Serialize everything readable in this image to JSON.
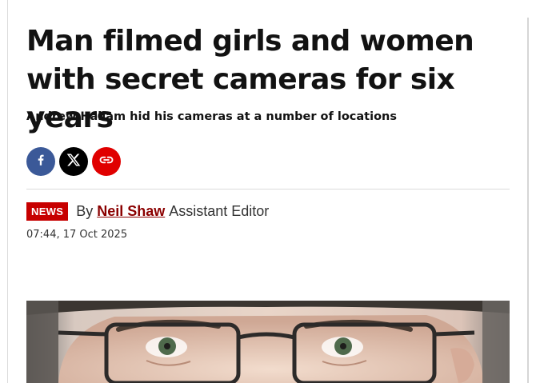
{
  "article": {
    "headline": "Man filmed girls and women with secret cameras for six years",
    "standfirst": "Andrew Hallam hid his cameras at a number of locations",
    "category_badge": "NEWS",
    "byline_prefix": "By",
    "author": "Neil Shaw",
    "author_role": "Assistant Editor",
    "published": "07:44, 17 Oct 2025"
  },
  "share": {
    "buttons": [
      {
        "network": "facebook",
        "icon": "facebook-icon",
        "color": "#3b5998"
      },
      {
        "network": "x",
        "icon": "x-icon",
        "color": "#000000"
      },
      {
        "network": "copy-link",
        "icon": "link-icon",
        "color": "#e00000"
      }
    ]
  },
  "colors": {
    "badge": "#c70000",
    "author_link": "#8b0000"
  }
}
